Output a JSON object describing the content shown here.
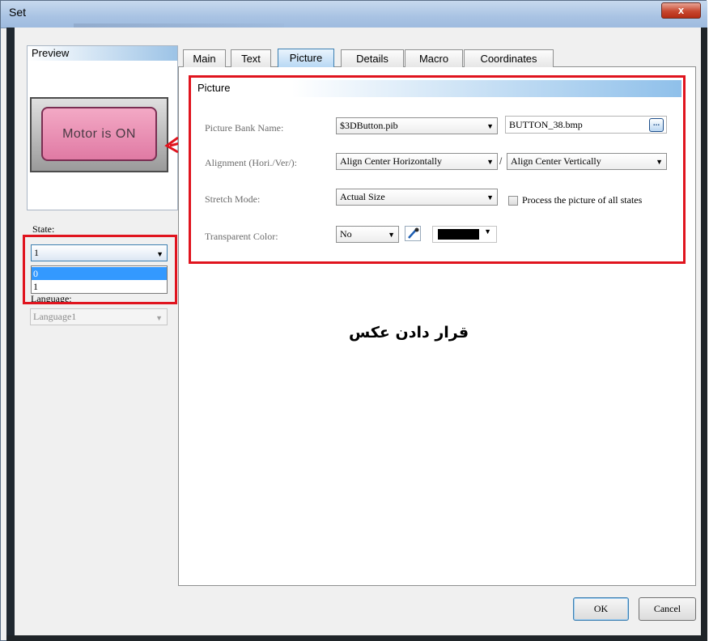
{
  "window": {
    "title": "Set",
    "close_glyph": "x"
  },
  "left": {
    "preview": {
      "header": "Preview",
      "button_text": "Motor is ON"
    },
    "state": {
      "label": "State:",
      "value": "1",
      "options": [
        "0",
        "1"
      ],
      "highlighted": "0"
    },
    "language": {
      "label": "Language:",
      "value": "Language1"
    }
  },
  "tabs": [
    {
      "label": "Main",
      "active": false
    },
    {
      "label": "Text",
      "active": false
    },
    {
      "label": "Picture",
      "active": true
    },
    {
      "label": "Details",
      "active": false
    },
    {
      "label": "Macro",
      "active": false
    },
    {
      "label": "Coordinates",
      "active": false
    }
  ],
  "picture": {
    "header": "Picture",
    "bank_label": "Picture Bank Name:",
    "bank_value": "$3DButton.pib",
    "file_name": "BUTTON_38.bmp",
    "browse_label": "...",
    "alignment_label": "Alignment (Hori./Ver/):",
    "align_h_value": "Align Center Horizontally",
    "align_sep": "/",
    "align_v_value": "Align Center Vertically",
    "stretch_label": "Stretch Mode:",
    "stretch_value": "Actual Size",
    "process_all_label": "Process the picture of all states",
    "transparent_label": "Transparent Color:",
    "transparent_value": "No",
    "transparent_color": "#000000"
  },
  "annotation": {
    "text": "قرار دادن عکس"
  },
  "buttons": {
    "ok": "OK",
    "cancel": "Cancel"
  },
  "colors": {
    "annotation_red": "#e0141e",
    "tab_active": "#b8d8f4",
    "selection_blue": "#3399ff"
  }
}
